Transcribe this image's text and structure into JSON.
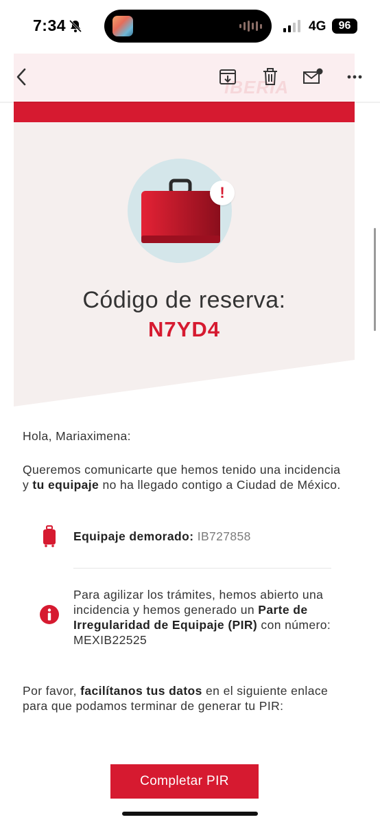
{
  "status_bar": {
    "time": "7:34",
    "network": "4G",
    "battery": "96"
  },
  "email_header": {
    "brand": "IBERIA",
    "colors": {
      "brand_red": "#d61a30",
      "hero_bg": "#f5efee",
      "bag_circle": "#d4e6ea"
    }
  },
  "toolbar": {
    "back_icon": "chevron-left-icon",
    "archive_icon": "archive-icon",
    "delete_icon": "trash-icon",
    "mark_unread_icon": "mail-unread-icon",
    "more_icon": "more-icon"
  },
  "hero": {
    "code_label": "Código de reserva:",
    "code_value": "N7YD4",
    "alert_mark": "!"
  },
  "body": {
    "greeting": "Hola, Mariaximena:",
    "intro_part1": "Queremos comunicarte que hemos tenido una incidencia y ",
    "intro_bold": "tu equipaje",
    "intro_part2": " no ha llegado contigo a Ciudad de México.",
    "luggage_label": "Equipaje demorado:",
    "luggage_ref": "IB727858",
    "pir_part1": "Para agilizar los trámites, hemos abierto una incidencia y hemos generado un ",
    "pir_bold": "Parte de Irregularidad de Equipaje (PIR)",
    "pir_part2": " con número: MEXIB22525",
    "outro_part1": "Por favor, ",
    "outro_bold": "facilítanos tus datos",
    "outro_part2": " en el siguiente enlace para que podamos terminar de generar tu PIR:",
    "cta_label": "Completar PIR"
  }
}
